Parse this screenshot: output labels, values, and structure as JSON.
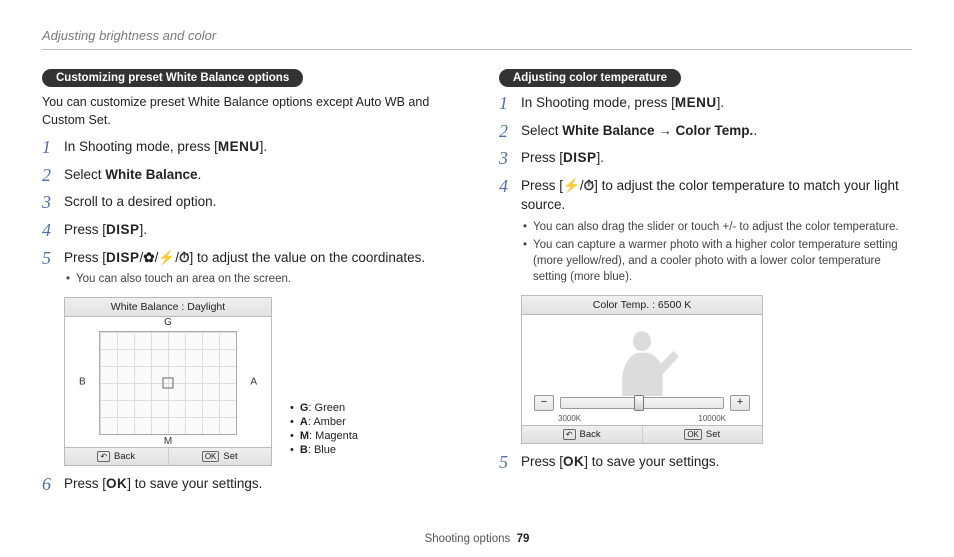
{
  "page_title": "Adjusting brightness and color",
  "footer": {
    "section": "Shooting options",
    "page": "79"
  },
  "left": {
    "pill": "Customizing preset White Balance options",
    "intro_pre": "You can customize preset White Balance options except ",
    "intro_b1": "Auto WB",
    "intro_mid": " and ",
    "intro_b2": "Custom Set",
    "intro_post": ".",
    "steps": [
      {
        "n": "1",
        "pre": "In Shooting mode, press [",
        "btn": "MENU",
        "post": "]."
      },
      {
        "n": "2",
        "pre": "Select ",
        "bold": "White Balance",
        "post": "."
      },
      {
        "n": "3",
        "pre": "Scroll to a desired option."
      },
      {
        "n": "4",
        "pre": "Press [",
        "btn": "DISP",
        "post": "]."
      },
      {
        "n": "5",
        "line": "press_combo",
        "bullets": [
          "You can also touch an area on the screen."
        ]
      },
      {
        "n": "6",
        "pre": "Press [",
        "btn": "OK",
        "post": "] to save your settings."
      }
    ],
    "combo_pre": "Press [",
    "combo_post": "] to adjust the value on the coordinates.",
    "buttons": {
      "disp": "DISP",
      "ok": "OK"
    },
    "figure": {
      "title": "White Balance : Daylight",
      "axes": {
        "top": "G",
        "right": "A",
        "bottom": "M",
        "left": "B"
      },
      "back": "Back",
      "set": "Set"
    },
    "legend": [
      {
        "k": "G",
        "v": "Green"
      },
      {
        "k": "A",
        "v": "Amber"
      },
      {
        "k": "M",
        "v": "Magenta"
      },
      {
        "k": "B",
        "v": "Blue"
      }
    ]
  },
  "right": {
    "pill": "Adjusting color temperature",
    "steps": [
      {
        "n": "1",
        "pre": "In Shooting mode, press [",
        "btn": "MENU",
        "post": "]."
      },
      {
        "n": "2",
        "pre": "Select ",
        "bold": "White Balance → Color Temp.",
        "post": "."
      },
      {
        "n": "3",
        "pre": "Press [",
        "btn": "DISP",
        "post": "]."
      },
      {
        "n": "4",
        "line": "press_pair",
        "bullets": [
          "You can also drag the slider or touch +/- to adjust the color temperature.",
          "You can capture a warmer photo with a higher color temperature setting (more yellow/red), and a cooler photo with a lower color temperature setting (more blue)."
        ]
      },
      {
        "n": "5",
        "pre": "Press [",
        "btn": "OK",
        "post": "] to save your settings."
      }
    ],
    "pair_pre": "Press [",
    "pair_post": "] to adjust the color temperature to match your light source.",
    "figure": {
      "title": "Color Temp. : 6500 K",
      "min": "3000K",
      "max": "10000K",
      "back": "Back",
      "set": "Set"
    }
  }
}
